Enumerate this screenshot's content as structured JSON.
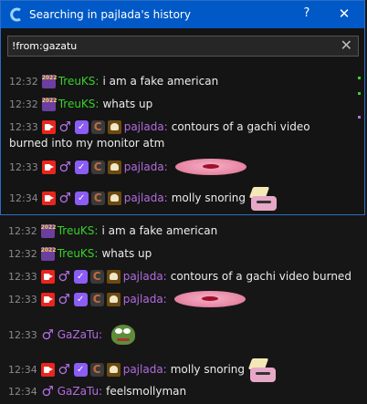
{
  "window": {
    "title": "Searching in pajlada's history",
    "help_label": "?",
    "close_label": "✕"
  },
  "search": {
    "value": "!from:gazatu",
    "clear_label": "✕"
  },
  "badges": {
    "year": "2022",
    "verified": "✓",
    "chatterino": "C",
    "male": "♂"
  },
  "dialog_messages": [
    {
      "time": "12:32",
      "user": "TreuKS:",
      "text": "i am a fake american"
    },
    {
      "time": "12:32",
      "user": "TreuKS:",
      "text": "whats up"
    },
    {
      "time": "12:33",
      "user": "pajlada:",
      "text": "contours of a gachi video",
      "text_cont": "burned into my monitor atm"
    },
    {
      "time": "12:33",
      "user": "pajlada:",
      "text": ""
    },
    {
      "time": "12:34",
      "user": "pajlada:",
      "text": "molly snoring"
    }
  ],
  "chat_messages": [
    {
      "time": "12:32",
      "user": "TreuKS:",
      "text": "i am a fake american"
    },
    {
      "time": "12:32",
      "user": "TreuKS:",
      "text": "whats up"
    },
    {
      "time": "12:33",
      "user": "pajlada:",
      "text": "contours of a gachi video burned"
    },
    {
      "time": "12:33",
      "user": "pajlada:",
      "text": ""
    },
    {
      "time": "12:33",
      "user": "GaZaTu:",
      "text": ""
    },
    {
      "time": "12:34",
      "user": "pajlada:",
      "text": "molly snoring"
    },
    {
      "time": "12:34",
      "user": "GaZaTu:",
      "text": "feelsmollyman"
    }
  ],
  "colors": {
    "accent": "#0059c7",
    "treuks": "#37d12b",
    "pajlada": "#b26ce0",
    "gazatu": "#b26ce0"
  }
}
